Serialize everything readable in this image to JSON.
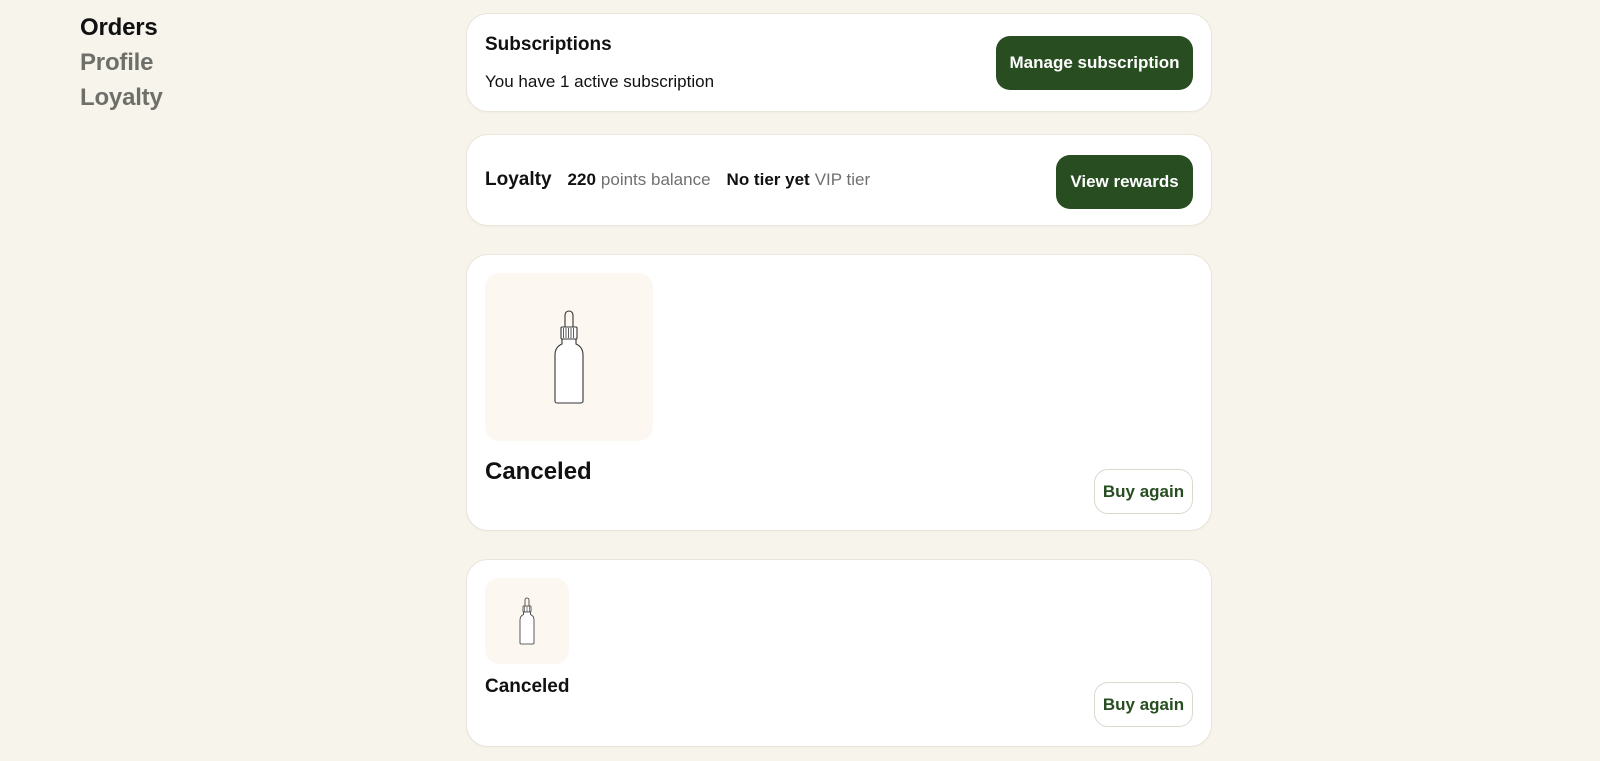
{
  "nav": {
    "items": [
      {
        "label": "Orders",
        "active": true
      },
      {
        "label": "Profile",
        "active": false
      },
      {
        "label": "Loyalty",
        "active": false
      }
    ]
  },
  "subscriptions": {
    "title": "Subscriptions",
    "status_text": "You have 1 active subscription",
    "button_label": "Manage subscription"
  },
  "loyalty": {
    "title": "Loyalty",
    "points_value": "220",
    "points_label": "points balance",
    "tier_value": "No tier yet",
    "tier_label": "VIP tier",
    "button_label": "View rewards"
  },
  "orders": [
    {
      "status": "Canceled",
      "button_label": "Buy again",
      "image_icon": "dropper-bottle-icon"
    },
    {
      "status": "Canceled",
      "button_label": "Buy again",
      "image_icon": "dropper-bottle-icon"
    }
  ],
  "colors": {
    "page_background": "#f7f4ec",
    "primary_button": "#274d21",
    "card_background": "#ffffff",
    "thumbnail_background": "#fcf8f1"
  }
}
